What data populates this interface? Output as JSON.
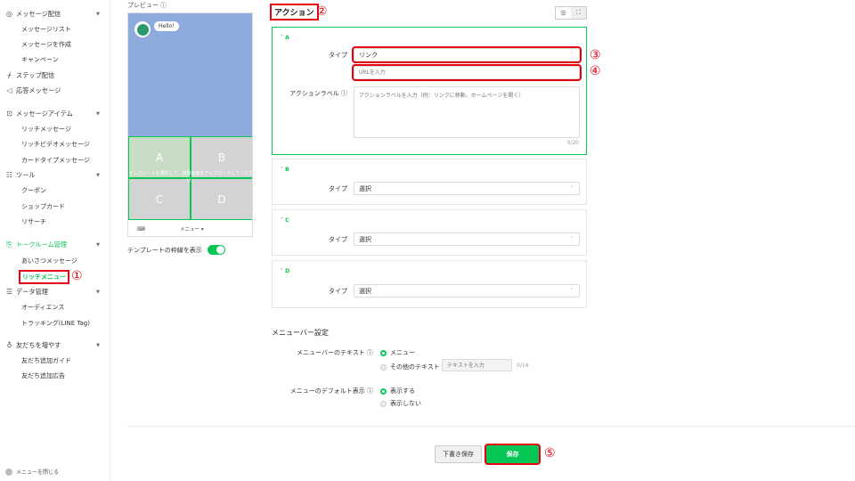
{
  "sidebar": {
    "sections": [
      {
        "label": "メッセージ配信",
        "icon": "broadcast-icon",
        "expanded": true,
        "items": [
          "メッセージリスト",
          "メッセージを作成",
          "キャンペーン"
        ]
      },
      {
        "label": "ステップ配信",
        "icon": "step-icon"
      },
      {
        "label": "応答メッセージ",
        "icon": "reply-icon"
      },
      {
        "label": "メッセージアイテム",
        "icon": "item-icon",
        "expanded": true,
        "items": [
          "リッチメッセージ",
          "リッチビデオメッセージ",
          "カードタイプメッセージ"
        ]
      },
      {
        "label": "ツール",
        "icon": "tool-icon",
        "expanded": true,
        "items": [
          "クーポン",
          "ショップカード",
          "リサーチ"
        ]
      },
      {
        "label": "トークルーム管理",
        "icon": "chatroom-icon",
        "expanded": true,
        "active": true,
        "items": [
          "あいさつメッセージ",
          "リッチメニュー"
        ]
      },
      {
        "label": "データ管理",
        "icon": "database-icon",
        "expanded": true,
        "items": [
          "オーディエンス",
          "トラッキング(LINE Tag)"
        ]
      },
      {
        "label": "友だちを増やす",
        "icon": "friends-icon",
        "expanded": true,
        "items": [
          "友だち追加ガイド",
          "友だち追加広告"
        ]
      }
    ],
    "current_item": "リッチメニュー",
    "footer": "メニューを閉じる"
  },
  "markers": {
    "m1": "①",
    "m2": "②",
    "m3": "③",
    "m4": "④",
    "m5": "⑤"
  },
  "preview": {
    "title": "プレビュー ⓘ",
    "bubble": "Hello!",
    "cells": {
      "a": "A",
      "b": "B",
      "c": "C",
      "d": "D"
    },
    "overlay_text": "テンプレートを選択して、背景画像をアップロードしてください。",
    "keyboard_icon": "keyboard-icon",
    "menu_bar_label": "メニュー ▾",
    "toggle_label": "テンプレートの枠線を表示",
    "toggle_on": true
  },
  "actions": {
    "title": "アクション",
    "type_label": "タイプ",
    "a": {
      "header": "˅ A",
      "type_value": "リンク",
      "url_placeholder": "URLを入力",
      "action_label": "アクションラベル ⓘ",
      "action_placeholder": "アクションラベルを入力（例：リンクに移動、ホームページを開く）",
      "counter": "0/20"
    },
    "b": {
      "header": "˅ B",
      "type_value": "選択"
    },
    "c": {
      "header": "˅ C",
      "type_value": "選択"
    },
    "d": {
      "header": "˅ D",
      "type_value": "選択"
    }
  },
  "menubar": {
    "title": "メニューバー設定",
    "text_label": "メニューバーのテキスト ⓘ",
    "opt_menu": "メニュー",
    "opt_other": "その他のテキスト",
    "other_placeholder": "テキストを入力",
    "other_counter": "0/14",
    "default_label": "メニューのデフォルト表示 ⓘ",
    "opt_show": "表示する",
    "opt_hide": "表示しない"
  },
  "buttons": {
    "draft": "下書き保存",
    "save": "保存"
  },
  "colors": {
    "accent": "#06c755",
    "highlight": "#e60012"
  }
}
